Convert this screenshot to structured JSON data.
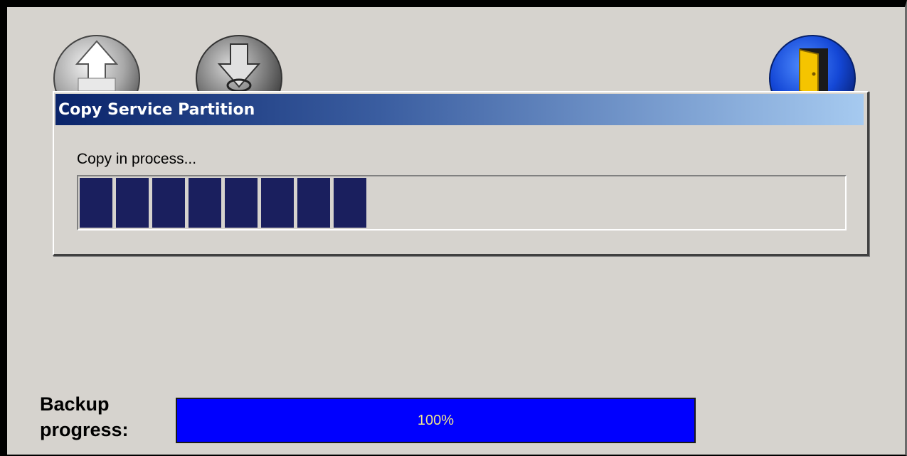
{
  "toolbar": {
    "backup_icon": "upload-arrow-icon",
    "restore_icon": "download-arrow-icon",
    "exit_icon": "exit-door-icon"
  },
  "dialog": {
    "title": "Copy Service Partition",
    "status": "Copy in process...",
    "progress_chunks_filled": 8,
    "chunk_color": "#1a1f5e"
  },
  "backup": {
    "label": "Backup\nprogress:",
    "percent_text": "100%",
    "percent_value": 100,
    "bar_color": "#0000ff",
    "text_color": "#f0e68c"
  },
  "colors": {
    "title_gradient_start": "#0a246a",
    "title_gradient_end": "#a6caf0",
    "background": "#d6d3ce"
  }
}
